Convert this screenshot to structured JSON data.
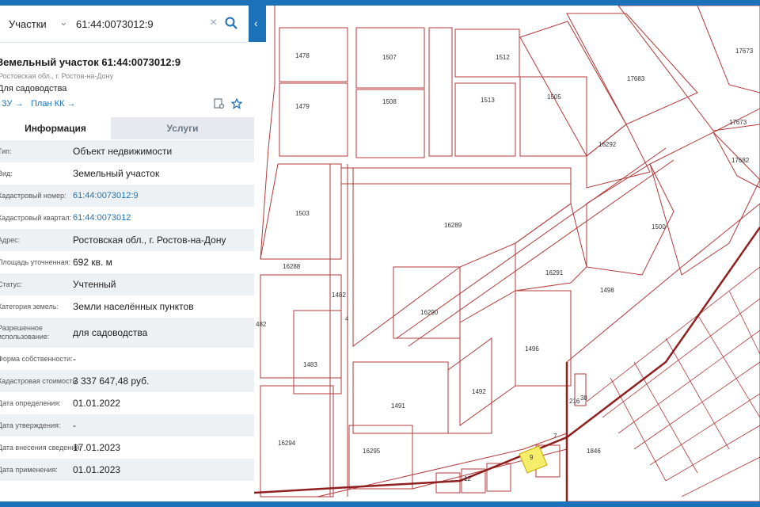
{
  "search": {
    "type_label": "Участки",
    "query": "61:44:0073012:9"
  },
  "object": {
    "title": "Земельный участок 61:44:0073012:9",
    "address": "Ростовская обл., г. Ростов-на-Дону",
    "use": "Для садоводства",
    "link_zu": "ЗУ →",
    "link_plan": "План КК →"
  },
  "tabs": {
    "info": "Информация",
    "services": "Услуги"
  },
  "rows": [
    {
      "label": "Тип:",
      "value": "Объект недвижимости"
    },
    {
      "label": "Вид:",
      "value": "Земельный участок"
    },
    {
      "label": "Кадастровый номер:",
      "value": "61:44:0073012:9"
    },
    {
      "label": "Кадастровый квартал:",
      "value": "61:44:0073012"
    },
    {
      "label": "Адрес:",
      "value": "Ростовская обл., г. Ростов-на-Дону"
    },
    {
      "label": "Площадь уточненная:",
      "value": "692 кв. м"
    },
    {
      "label": "Статус:",
      "value": "Учтенный"
    },
    {
      "label": "Категория земель:",
      "value": "Земли населённых пунктов"
    },
    {
      "label": "Разрешенное использование:",
      "value": "для садоводства"
    },
    {
      "label": "Форма собственности:",
      "value": "-"
    },
    {
      "label": "Кадастровая стоимость:",
      "value": "3 337 647,48 руб."
    },
    {
      "label": "Дата определения:",
      "value": "01.01.2022"
    },
    {
      "label": "Дата утверждения:",
      "value": "-"
    },
    {
      "label": "Дата внесения сведений:",
      "value": "17.01.2023"
    },
    {
      "label": "Дата применения:",
      "value": "01.01.2023"
    }
  ],
  "map_labels": [
    "1478",
    "1507",
    "1512",
    "17673",
    "1479",
    "1508",
    "1513",
    "1505",
    "17683",
    "16288",
    "16292",
    "17682",
    "1503",
    "16289",
    "1500",
    "16291",
    "1498",
    "482",
    "16290",
    "1496",
    "1483",
    "1492",
    "1491",
    "16294",
    "16295",
    "4",
    "216",
    "38",
    "9",
    "7",
    "12",
    "1846",
    "17673",
    "1482"
  ],
  "colors": {
    "accent": "#1c72b8",
    "parcel_line": "#b23a3a",
    "selected_parcel": "#f6ee6a"
  }
}
